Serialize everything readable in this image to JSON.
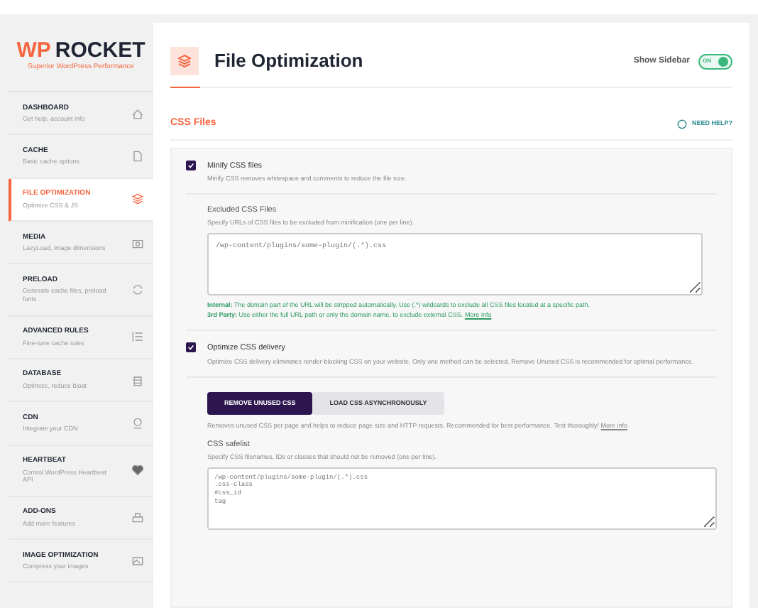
{
  "logo": {
    "wordmark_first": "WP",
    "wordmark_second": "ROCKET",
    "tagline": "Superior WordPress Performance"
  },
  "sidebar": {
    "items": [
      {
        "title": "DASHBOARD",
        "subtitle": "Get help, account info",
        "selected": false
      },
      {
        "title": "CACHE",
        "subtitle": "Basic cache options",
        "selected": false
      },
      {
        "title": "FILE OPTIMIZATION",
        "subtitle": "Optimize CSS & JS",
        "selected": true
      },
      {
        "title": "MEDIA",
        "subtitle": "LazyLoad, image dimensions",
        "selected": false
      },
      {
        "title": "PRELOAD",
        "subtitle": "Generate cache files, preload fonts",
        "selected": false
      },
      {
        "title": "ADVANCED RULES",
        "subtitle": "Fine-tune cache rules",
        "selected": false
      },
      {
        "title": "DATABASE",
        "subtitle": "Optimize, reduce bloat",
        "selected": false
      },
      {
        "title": "CDN",
        "subtitle": "Integrate your CDN",
        "selected": false
      },
      {
        "title": "HEARTBEAT",
        "subtitle": "Control WordPress Heartbeat API",
        "selected": false
      },
      {
        "title": "ADD-ONS",
        "subtitle": "Add more features",
        "selected": false
      },
      {
        "title": "IMAGE OPTIMIZATION",
        "subtitle": "Compress your images",
        "selected": false
      }
    ]
  },
  "header": {
    "title": "File Optimization",
    "show_sidebar_label": "Show Sidebar",
    "show_sidebar_toggle": {
      "on": true,
      "label": "ON"
    }
  },
  "section": {
    "title": "CSS Files",
    "help_link": "NEED HELP?"
  },
  "minify": {
    "label": "Minify CSS files",
    "checked": true,
    "description": "Minify CSS removes whitespace and comments to reduce the file size."
  },
  "excluded": {
    "label": "Excluded CSS Files",
    "description": "Specify URLs of CSS files to be excluded from minification (one per line).",
    "value": "/wp-content/plugins/some-plugin/(.*).css",
    "notes": [
      "**Internal:** The domain part of the URL will be stripped automatically. Use (.*) wildcards to exclude all CSS files located at a specific path.",
      "**3rd Party:** Use either the full URL path or only the domain name, to exclude external CSS."
    ],
    "more_info": "More info"
  },
  "delivery": {
    "label": "Optimize CSS delivery",
    "checked": true,
    "description": "Optimize CSS delivery eliminates render-blocking CSS on your website. Only one method can be selected. Remove Unused CSS is recommended for optimal performance.",
    "methods": [
      {
        "label": "REMOVE UNUSED CSS",
        "selected": true
      },
      {
        "label": "LOAD CSS ASYNCHRONOUSLY",
        "selected": false
      }
    ],
    "method_description": "Removes unused CSS per page and helps to reduce page size and HTTP requests. Recommended for best performance. Test thoroughly!",
    "more_info": "More info"
  },
  "safelist": {
    "label": "CSS safelist",
    "description": "Specify CSS filenames, IDs or classes that should not be removed (one per line).",
    "value": "/wp-content/plugins/some-plugin/(.*).css\n.css-class\n#css_id\ntag"
  }
}
